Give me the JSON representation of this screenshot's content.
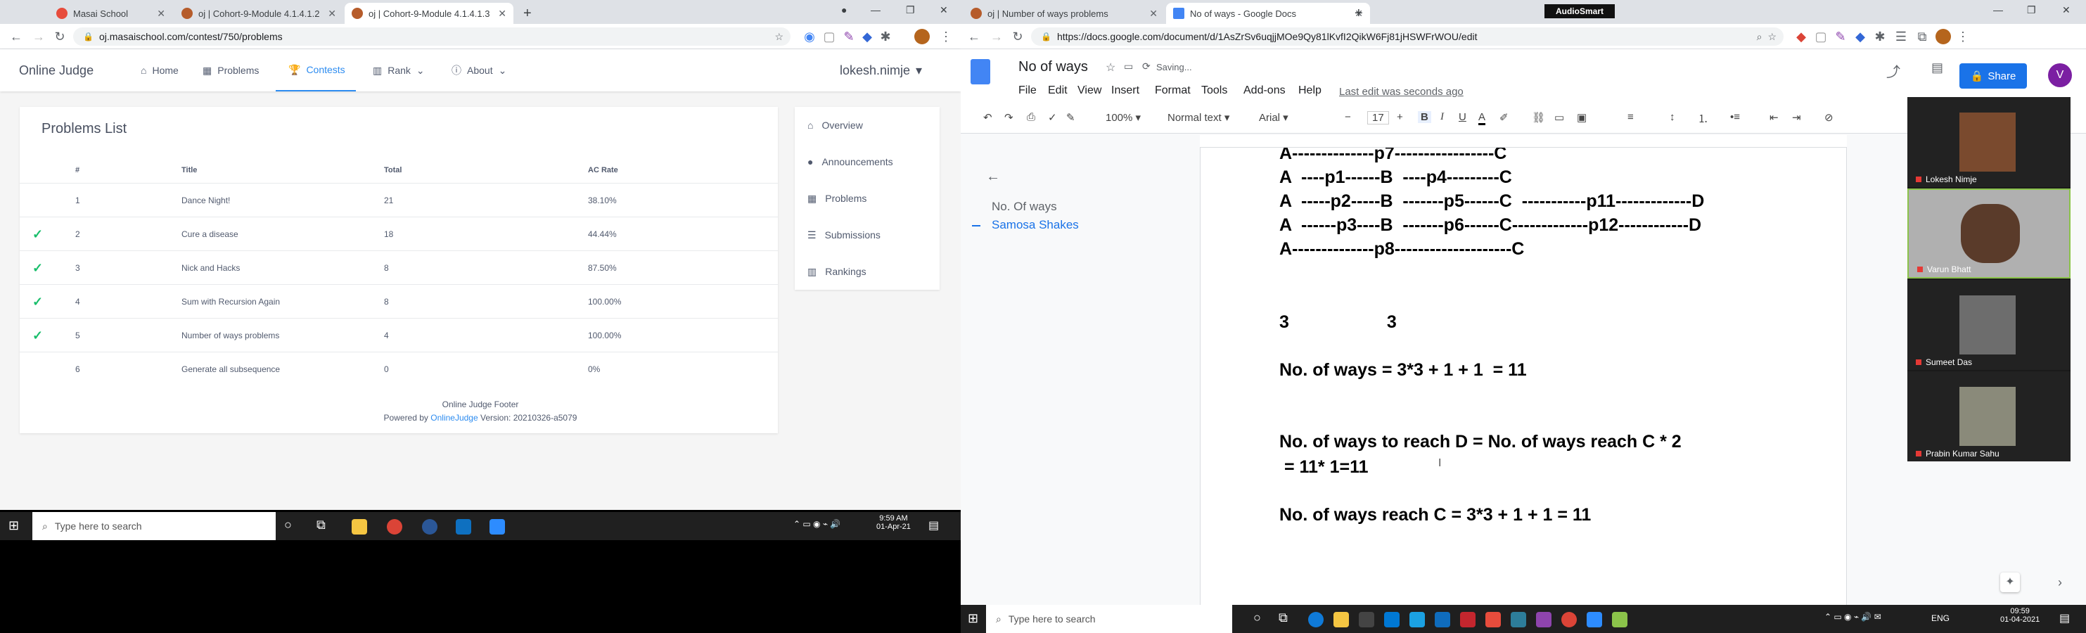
{
  "left_browser": {
    "tabs": [
      {
        "title": "Masai School"
      },
      {
        "title": "oj | Cohort-9-Module 4.1.4.1.2"
      },
      {
        "title": "oj | Cohort-9-Module 4.1.4.1.3"
      }
    ],
    "url": "oj.masaischool.com/contest/750/problems"
  },
  "oj": {
    "brand": "Online Judge",
    "nav": {
      "home": "Home",
      "problems": "Problems",
      "contests": "Contests",
      "rank": "Rank",
      "about": "About"
    },
    "user": "lokesh.nimje",
    "problems_title": "Problems List",
    "columns": [
      "#",
      "Title",
      "Total",
      "AC Rate"
    ],
    "rows": [
      {
        "solved": false,
        "num": "1",
        "title": "Dance Night!",
        "total": "21",
        "ac": "38.10%"
      },
      {
        "solved": true,
        "num": "2",
        "title": "Cure a disease",
        "total": "18",
        "ac": "44.44%"
      },
      {
        "solved": true,
        "num": "3",
        "title": "Nick and Hacks",
        "total": "8",
        "ac": "87.50%"
      },
      {
        "solved": true,
        "num": "4",
        "title": "Sum with Recursion Again",
        "total": "8",
        "ac": "100.00%"
      },
      {
        "solved": true,
        "num": "5",
        "title": "Number of ways problems",
        "total": "4",
        "ac": "100.00%"
      },
      {
        "solved": false,
        "num": "6",
        "title": "Generate all subsequence",
        "total": "0",
        "ac": "0%"
      }
    ],
    "side_menu": [
      "Overview",
      "Announcements",
      "Problems",
      "Submissions",
      "Rankings"
    ],
    "footer_line1": "Online Judge Footer",
    "footer_powered": "Powered by",
    "footer_link": "OnlineJudge",
    "footer_version": "Version: 20210326-a5079"
  },
  "left_taskbar": {
    "search": "Type here to search",
    "time": "9:59 AM",
    "date": "01-Apr-21"
  },
  "right_browser": {
    "tabs": [
      {
        "title": "oj | Number of ways problems"
      },
      {
        "title": "No of ways - Google Docs"
      }
    ],
    "url": "https://docs.google.com/document/d/1AsZrSv6uqjjMOe9Qy81lKvfI2QikW6Fj81jHSWFrWOU/edit",
    "audiosmart": "AudioSmart"
  },
  "gdoc": {
    "title": "No of ways",
    "saving": "Saving...",
    "menus": [
      "File",
      "Edit",
      "View",
      "Insert",
      "Format",
      "Tools",
      "Add-ons",
      "Help"
    ],
    "last_edit": "Last edit was seconds ago",
    "share": "Share",
    "avatar": "V",
    "zoom": "100%",
    "style": "Normal text",
    "font": "Arial",
    "font_size": "17",
    "outline": [
      "No. Of ways",
      "Samosa Shakes"
    ],
    "lines": [
      "A--------------p7-----------------C",
      "A  ----p1------B  ----p4---------C",
      "A  -----p2-----B  -------p5------C  -----------p11-------------D",
      "A  ------p3----B  -------p6------C-------------p12------------D",
      "A--------------p8--------------------C",
      "3                    3",
      "No. of ways = 3*3 + 1 + 1  = 11",
      "No. of ways to reach D = No. of ways reach C * 2",
      " = 11* 1=11",
      "No. of ways reach C = 3*3 + 1 + 1 = 11"
    ]
  },
  "participants": [
    "Lokesh Nimje",
    "Varun Bhatt",
    "Sumeet Das",
    "Prabin Kumar Sahu"
  ],
  "right_taskbar": {
    "search": "Type here to search",
    "lang": "ENG",
    "time": "09:59",
    "date": "01-04-2021"
  }
}
